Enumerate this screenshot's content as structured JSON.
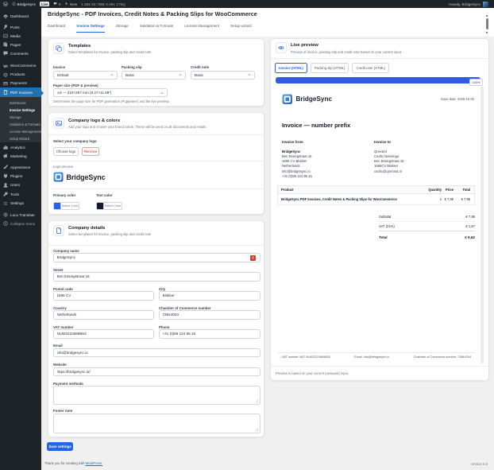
{
  "admin_bar": {
    "site_name": "BridgeSync",
    "live_badge": "Live",
    "comments_count": "0",
    "new_label": "New",
    "stats": "1.38s 93.7MB 0.09s 175Q",
    "howdy": "Howdy, BridgeSync"
  },
  "sidebar": {
    "items": [
      {
        "label": "Dashboard"
      },
      {
        "label": "Posts"
      },
      {
        "label": "Media"
      },
      {
        "label": "Pages"
      },
      {
        "label": "Comments"
      },
      {
        "label": "WooCommerce"
      },
      {
        "label": "Products"
      },
      {
        "label": "Payments"
      },
      {
        "label": "PDF Invoices"
      },
      {
        "label": "Analytics"
      },
      {
        "label": "Marketing"
      },
      {
        "label": "Appearance"
      },
      {
        "label": "Plugins"
      },
      {
        "label": "Users"
      },
      {
        "label": "Tools"
      },
      {
        "label": "Settings"
      },
      {
        "label": "Loco Translate"
      },
      {
        "label": "Collapse menu"
      }
    ],
    "submenu": [
      {
        "label": "Dashboard"
      },
      {
        "label": "Invoice Settings"
      },
      {
        "label": "Storage"
      },
      {
        "label": "Validation & Formats"
      },
      {
        "label": "License Management"
      },
      {
        "label": "Setup Wizard"
      }
    ]
  },
  "header": {
    "title": "BridgeSync - PDF Invoices, Credit Notes & Packing Slips for WooCommerce",
    "tabs": [
      {
        "label": "Dashboard"
      },
      {
        "label": "Invoice Settings"
      },
      {
        "label": "Storage"
      },
      {
        "label": "Validation & Formats"
      },
      {
        "label": "License Management"
      },
      {
        "label": "Setup wizard"
      }
    ],
    "active_tab": "Invoice Settings"
  },
  "templates_card": {
    "title": "Templates",
    "subtitle": "Select templates for invoice, packing slip and credit note",
    "invoice": {
      "label": "Invoice",
      "value": "Default"
    },
    "packing_slip": {
      "label": "Packing slip",
      "value": "Basic"
    },
    "credit_note": {
      "label": "Credit note",
      "value": "Basic"
    },
    "paper_size": {
      "label": "Paper size (PDF & preview)",
      "value": "A4 — 210×297 mm (8.27×11.69\")",
      "help": "Determines the page size for PDF generation (Puppeteer) and the live preview."
    }
  },
  "logo_card": {
    "title": "Company logo & colors",
    "subtitle": "Add your logo and choose your brand colors. These will be used on all documents and emails.",
    "select_logo_label": "Select your company logo",
    "choose_button": "Choose logo",
    "remove_button": "Remove",
    "preview_label": "Logo preview",
    "logo_text": "BridgeSync",
    "primary_color_label": "Primary color",
    "text_color_label": "Text color",
    "select_color_button": "Select Color",
    "primary_color": "#2563eb",
    "text_color": "#131c2b"
  },
  "details_card": {
    "title": "Company details",
    "subtitle": "Select templates for invoice, packing slip and credit note",
    "company_name": {
      "label": "Company name",
      "value": "BridgeSync"
    },
    "street": {
      "label": "Street",
      "value": "Ben Essingstraat 15"
    },
    "postal_code": {
      "label": "Postal code",
      "value": "1695 CV"
    },
    "city": {
      "label": "City",
      "value": "Blokker"
    },
    "country": {
      "label": "Country",
      "value": "Netherlands"
    },
    "coc": {
      "label": "Chamber of Commerce number",
      "value": "73844004"
    },
    "vat": {
      "label": "VAT number",
      "value": "NL802223669B53"
    },
    "phone": {
      "label": "Phone",
      "value": "+31 (0)85 124 95 15"
    },
    "email": {
      "label": "Email",
      "value": "info@bridgesync.io"
    },
    "website": {
      "label": "Website",
      "value": "https://bridgesync.io/"
    },
    "payment_methods": {
      "label": "Payment methods",
      "value": ""
    },
    "footer_note": {
      "label": "Footer note",
      "value": ""
    },
    "save_button": "Save settings"
  },
  "preview_card": {
    "title": "Live preview",
    "subtitle": "Preview of invoice, packing slip and credit note based on your current input.",
    "tabs": [
      {
        "label": "Invoice (HTML)"
      },
      {
        "label": "Packing slip (HTML)"
      },
      {
        "label": "Credit note (HTML)"
      }
    ],
    "active_tab": "Invoice (HTML)",
    "zoom": "100%",
    "note": "Preview is based on your current (unsaved) input.",
    "invoice": {
      "logo_text": "BridgeSync",
      "issue_date": "Issue date: 2025-10-02",
      "heading": "Invoice — number prefix",
      "from_label": "Invoice from",
      "from_lines": [
        {
          "text": "BridgeSync"
        },
        {
          "text": "Ben Essingstraat 15"
        },
        {
          "text": "1695 CV Blokker"
        },
        {
          "text": "Netherlands"
        },
        {
          "text": "info@bridgesync.io"
        },
        {
          "text": "+31 (0)85 124 95 15"
        }
      ],
      "to_label": "Invoice to",
      "to_lines": [
        {
          "text": "Qnected"
        },
        {
          "text": "Cedric Nanninga"
        },
        {
          "text": "Ben Essingstraat 15"
        },
        {
          "text": "1695CV Blokker"
        },
        {
          "text": "cedric@qnected.nl"
        }
      ],
      "table": {
        "headers": {
          "product": "Product",
          "quantity": "Quantity",
          "price": "Price",
          "total": "Total"
        },
        "row": {
          "product": "BridgeSync PDF Invoices, Credit Notes & Packing Slips for WooCommerce",
          "quantity": "1",
          "price": "€ 7,95",
          "total": "€ 7,95"
        }
      },
      "totals": {
        "subtotal_label": "Subtotal",
        "subtotal": "€ 7,95",
        "vat_label": "VAT (21%)",
        "vat": "€ 1,67",
        "total_label": "Total",
        "total": "€ 9,62"
      },
      "footer": {
        "vat": "VAT number VAT: NL802223669B53",
        "email": "Email: info@bridgesync.io",
        "coc": "Chamber of Commerce number: 73844004"
      }
    }
  },
  "footer": {
    "thanks": "Thank you for creating with ",
    "wordpress_link": "WordPress.",
    "version": "Version 6.9"
  }
}
